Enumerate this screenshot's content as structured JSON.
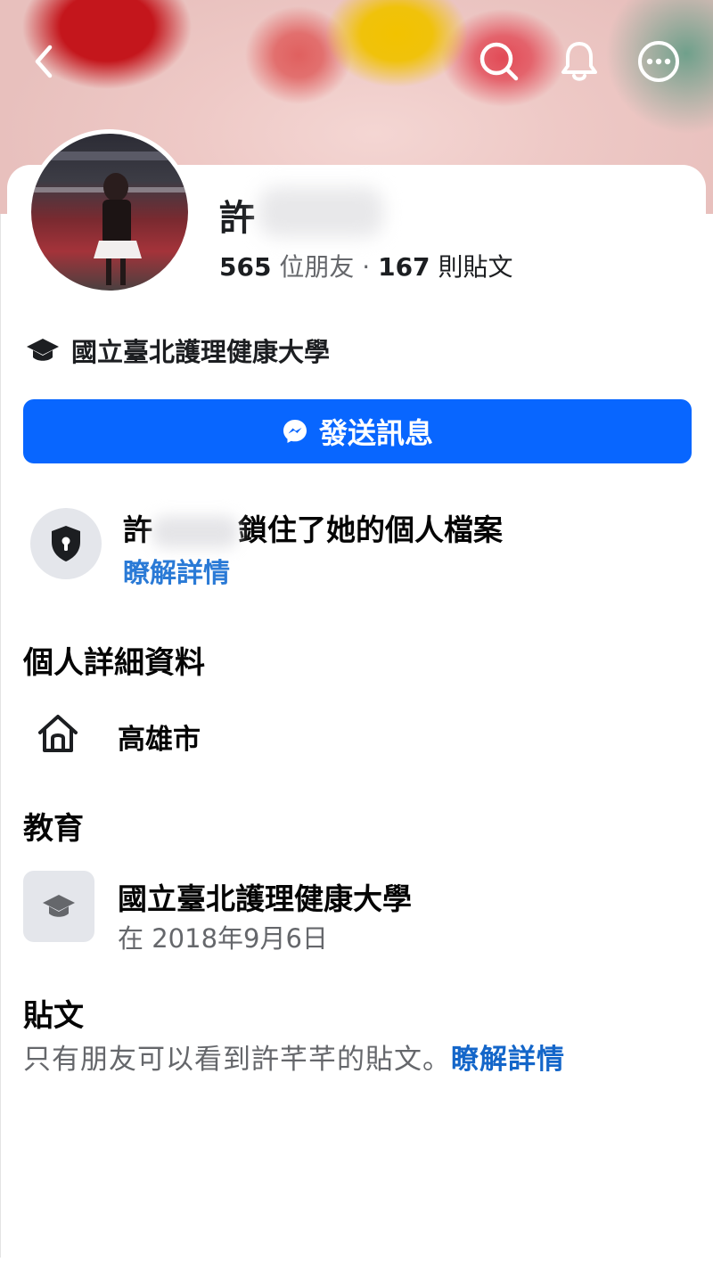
{
  "cover": {
    "back_icon": "chevron-left-icon",
    "search_icon": "search-icon",
    "bell_icon": "bell-icon",
    "more_icon": "more-icon"
  },
  "profile": {
    "name": "許",
    "friends_count": "565",
    "friends_label": "位朋友",
    "separator": "·",
    "posts_count": "167",
    "posts_label": "則貼文",
    "school": "國立臺北護理健康大學"
  },
  "message_button": {
    "label": "發送訊息",
    "icon": "messenger-icon"
  },
  "locked": {
    "prefix": "許",
    "suffix": "鎖住了她的個人檔案",
    "link": "瞭解詳情",
    "icon": "shield-lock-icon"
  },
  "details": {
    "heading": "個人詳細資料",
    "city": "高雄市",
    "city_icon": "home-icon"
  },
  "education": {
    "heading": "教育",
    "school": "國立臺北護理健康大學",
    "date": "在 2018年9月6日",
    "icon": "graduation-cap-icon"
  },
  "posts": {
    "heading": "貼文",
    "note": "只有朋友可以看到許芊芊的貼文。",
    "link": "瞭解詳情"
  },
  "colors": {
    "accent": "#0866ff",
    "link": "#1466c9",
    "muted_text": "#65676b",
    "icon_bg": "#e4e6eb"
  }
}
